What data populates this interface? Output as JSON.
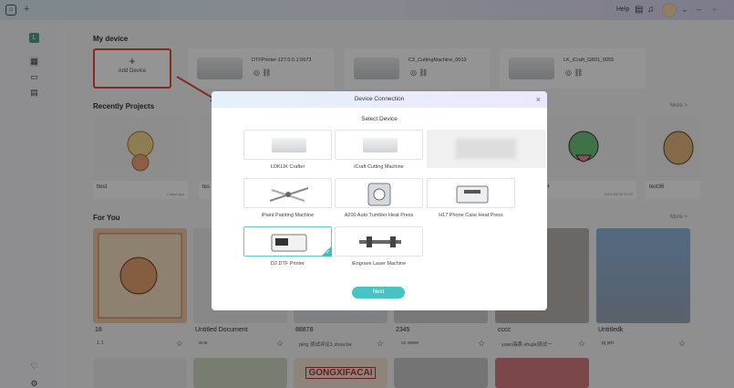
{
  "topbar": {
    "help": "Help"
  },
  "main": {
    "my_device_title": "My device",
    "add_device": {
      "plus": "+",
      "label": "Add Device"
    },
    "devices": [
      {
        "name": "DTFPrinter-127.0.0.1:5673"
      },
      {
        "name": "C2_CuttingMachine_0013"
      },
      {
        "name": "LK_iCraft_GB01_0055"
      }
    ],
    "recent_title": "Recently Projects",
    "more": "More >",
    "projects": [
      {
        "title": "ttest",
        "date": "7 days ago"
      },
      {
        "title": "tes",
        "date": ""
      },
      {
        "title": "H",
        "date": "2024-08-08 10:00"
      },
      {
        "title": "test36",
        "date": ""
      }
    ],
    "foryou_title": "For You",
    "foryou": [
      {
        "title": "18",
        "user": "1.1"
      },
      {
        "title": "Untitled Document",
        "user": "w.w"
      },
      {
        "title": "88878",
        "user": "ping 测试评论1 zhou1w"
      },
      {
        "title": "2345",
        "user": "cc www"
      },
      {
        "title": "cccc",
        "user": "yuan海燕 shujie测试一"
      },
      {
        "title": "Untitledk",
        "user": "jq jeh"
      }
    ],
    "gongxi": "GONGXIFACAI"
  },
  "modal": {
    "title": "Device Connection",
    "close": "×",
    "subtitle": "Select Device",
    "devices": [
      {
        "label": "LOKLIK Crafter",
        "selected": false
      },
      {
        "label": "iCraft Cutting Machine",
        "selected": false
      },
      {
        "label": "iPaint Painting Machine",
        "selected": false
      },
      {
        "label": "A200 Auto Tumbler Heat Press",
        "selected": false
      },
      {
        "label": "H17 Phone Case Heat Press",
        "selected": false
      },
      {
        "label": "D2 DTF Printer",
        "selected": true
      },
      {
        "label": "iEngrave Laser Machine",
        "selected": false
      }
    ],
    "next": "Next",
    "accent": "#46c3c4"
  }
}
